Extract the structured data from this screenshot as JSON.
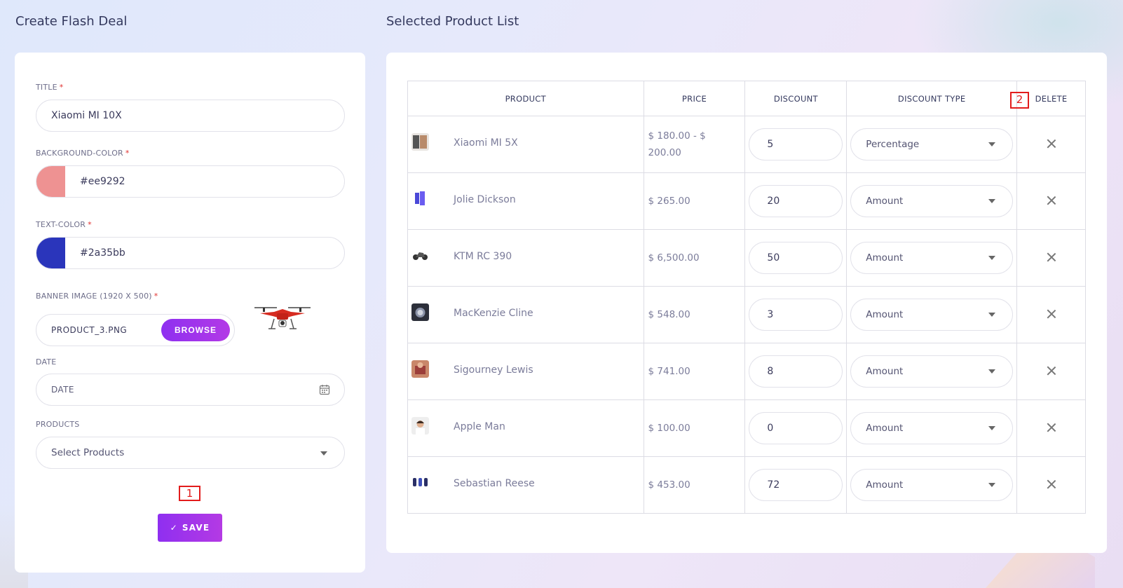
{
  "left_heading": "Create Flash Deal",
  "right_heading": "Selected Product List",
  "form": {
    "title_label": "TITLE",
    "title_value": "Xiaomi MI 10X",
    "bg_color_label": "BACKGROUND-COLOR",
    "bg_color_value": "#ee9292",
    "text_color_label": "TEXT-COLOR",
    "text_color_value": "#2a35bb",
    "banner_label": "BANNER IMAGE (1920 X 500)",
    "banner_file": "PRODUCT_3.PNG",
    "browse_label": "BROWSE",
    "date_label": "DATE",
    "date_placeholder": "DATE",
    "products_label": "PRODUCTS",
    "products_placeholder": "Select Products",
    "required_mark": "*",
    "save_label": "SAVE",
    "save_check": "✓"
  },
  "annotations": {
    "one": "1",
    "two": "2"
  },
  "table": {
    "headers": [
      "PRODUCT",
      "PRICE",
      "DISCOUNT",
      "DISCOUNT TYPE",
      "DELETE"
    ],
    "rows": [
      {
        "name": "Xiaomi MI 5X",
        "price": "$ 180.00 - $ 200.00",
        "discount": "5",
        "type": "Percentage"
      },
      {
        "name": "Jolie Dickson",
        "price": "$ 265.00",
        "discount": "20",
        "type": "Amount"
      },
      {
        "name": "KTM RC 390",
        "price": "$ 6,500.00",
        "discount": "50",
        "type": "Amount"
      },
      {
        "name": "MacKenzie Cline",
        "price": "$ 548.00",
        "discount": "3",
        "type": "Amount"
      },
      {
        "name": "Sigourney Lewis",
        "price": "$ 741.00",
        "discount": "8",
        "type": "Amount"
      },
      {
        "name": "Apple Man",
        "price": "$ 100.00",
        "discount": "0",
        "type": "Amount"
      },
      {
        "name": "Sebastian Reese",
        "price": "$ 453.00",
        "discount": "72",
        "type": "Amount"
      }
    ]
  },
  "colors": {
    "accent": "#9b34ec",
    "bg_swatch": "#ee9292",
    "text_swatch": "#2a35bb",
    "annotation": "#e21c1c"
  }
}
